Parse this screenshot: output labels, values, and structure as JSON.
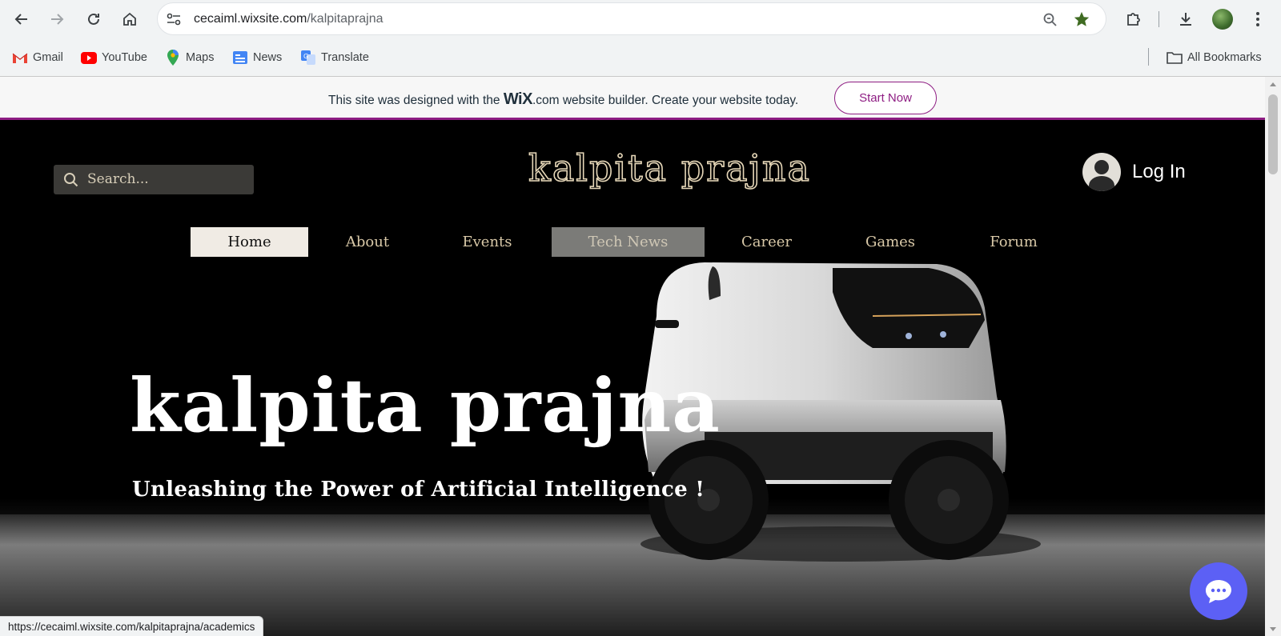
{
  "browser": {
    "url_host": "cecaiml.wixsite.com",
    "url_path": "/kalpitaprajna",
    "bookmarks": [
      {
        "label": "Gmail",
        "icon": "gmail-icon"
      },
      {
        "label": "YouTube",
        "icon": "youtube-icon"
      },
      {
        "label": "Maps",
        "icon": "maps-icon"
      },
      {
        "label": "News",
        "icon": "news-icon"
      },
      {
        "label": "Translate",
        "icon": "translate-icon"
      }
    ],
    "all_bookmarks": "All Bookmarks",
    "status_url": "https://cecaiml.wixsite.com/kalpitaprajna/academics"
  },
  "wix_banner": {
    "text_before": "This site was designed with the ",
    "brand": "WiX",
    "text_after": ".com website builder. Create your website today.",
    "button": "Start Now",
    "accent": "#8e1d83"
  },
  "site": {
    "search_placeholder": "Search...",
    "logo_text": "kalpita prajna",
    "login_label": "Log In",
    "nav": [
      {
        "label": "Home",
        "state": "active"
      },
      {
        "label": "About"
      },
      {
        "label": "Events"
      },
      {
        "label": "Tech News",
        "state": "hover"
      },
      {
        "label": "Career"
      },
      {
        "label": "Games"
      },
      {
        "label": "Forum"
      }
    ],
    "hero_title": "kalpita prajna",
    "hero_subtitle": "Unleashing the Power of Artificial Intelligence !",
    "chat_icon": "chat-bubble-icon"
  }
}
